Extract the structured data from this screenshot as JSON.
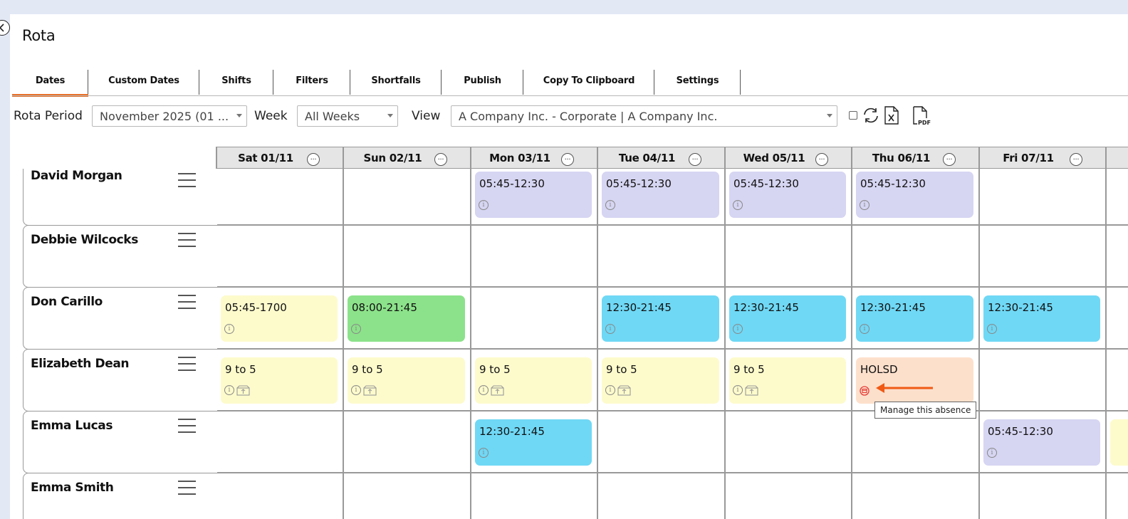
{
  "app": {
    "title": "Rota"
  },
  "tabs": [
    {
      "label": "Dates",
      "active": true
    },
    {
      "label": "Custom Dates",
      "active": false
    },
    {
      "label": "Shifts",
      "active": false
    },
    {
      "label": "Filters",
      "active": false
    },
    {
      "label": "Shortfalls",
      "active": false
    },
    {
      "label": "Publish",
      "active": false
    },
    {
      "label": "Copy To Clipboard",
      "active": false
    },
    {
      "label": "Settings",
      "active": false
    }
  ],
  "toolbar": {
    "rota_period_label": "Rota Period",
    "rota_period_value": "November 2025 (01 ...",
    "week_label": "Week",
    "week_value": "All Weeks",
    "view_label": "View",
    "view_value": "A Company Inc. - Corporate | A Company Inc.",
    "icons": [
      "checkbox",
      "refresh-icon",
      "excel-export-icon",
      "pdf-export-icon"
    ]
  },
  "days": [
    {
      "label": "Sat 01/11",
      "menu": "..."
    },
    {
      "label": "Sun 02/11",
      "menu": "..."
    },
    {
      "label": "Mon 03/11",
      "menu": "..."
    },
    {
      "label": "Tue 04/11",
      "menu": "..."
    },
    {
      "label": "Wed 05/11",
      "menu": "..."
    },
    {
      "label": "Thu 06/11",
      "menu": "..."
    },
    {
      "label": "Fri 07/11",
      "menu": "..."
    }
  ],
  "employees": [
    {
      "name": "David Morgan"
    },
    {
      "name": "Debbie Wilcocks"
    },
    {
      "name": "Don Carillo"
    },
    {
      "name": "Elizabeth Dean"
    },
    {
      "name": "Emma Lucas"
    },
    {
      "name": "Emma Smith"
    }
  ],
  "shifts": [
    {
      "row": 0,
      "col": 2,
      "label": "05:45-12:30",
      "color": "#d6d5f2"
    },
    {
      "row": 0,
      "col": 3,
      "label": "05:45-12:30",
      "color": "#d6d5f2"
    },
    {
      "row": 0,
      "col": 4,
      "label": "05:45-12:30",
      "color": "#d6d5f2"
    },
    {
      "row": 0,
      "col": 5,
      "label": "05:45-12:30",
      "color": "#d6d5f2"
    },
    {
      "row": 2,
      "col": 0,
      "label": "05:45-1700",
      "color": "#fdfbcc"
    },
    {
      "row": 2,
      "col": 1,
      "label": "08:00-21:45",
      "color": "#8ce28a"
    },
    {
      "row": 2,
      "col": 3,
      "label": "12:30-21:45",
      "color": "#6fd8f5"
    },
    {
      "row": 2,
      "col": 4,
      "label": "12:30-21:45",
      "color": "#6fd8f5"
    },
    {
      "row": 2,
      "col": 5,
      "label": "12:30-21:45",
      "color": "#6fd8f5"
    },
    {
      "row": 2,
      "col": 6,
      "label": "12:30-21:45",
      "color": "#6fd8f5"
    },
    {
      "row": 3,
      "col": 0,
      "label": "9 to 5",
      "color": "#fdfbcc"
    },
    {
      "row": 3,
      "col": 1,
      "label": "9 to 5",
      "color": "#fdfbcc"
    },
    {
      "row": 3,
      "col": 2,
      "label": "9 to 5",
      "color": "#fdfbcc"
    },
    {
      "row": 3,
      "col": 3,
      "label": "9 to 5",
      "color": "#fdfbcc"
    },
    {
      "row": 3,
      "col": 4,
      "label": "9 to 5",
      "color": "#fdfbcc"
    },
    {
      "row": 3,
      "col": 5,
      "label": "HOLSD",
      "color": "#fde0cc",
      "absence": true
    },
    {
      "row": 4,
      "col": 2,
      "label": "12:30-21:45",
      "color": "#6fd8f5"
    },
    {
      "row": 4,
      "col": 6,
      "label": "05:45-12:30",
      "color": "#d6d5f2"
    }
  ],
  "tooltip": {
    "text": "Manage this absence"
  },
  "colors": {
    "accent": "#e8702a",
    "arrow": "#f05a14"
  }
}
